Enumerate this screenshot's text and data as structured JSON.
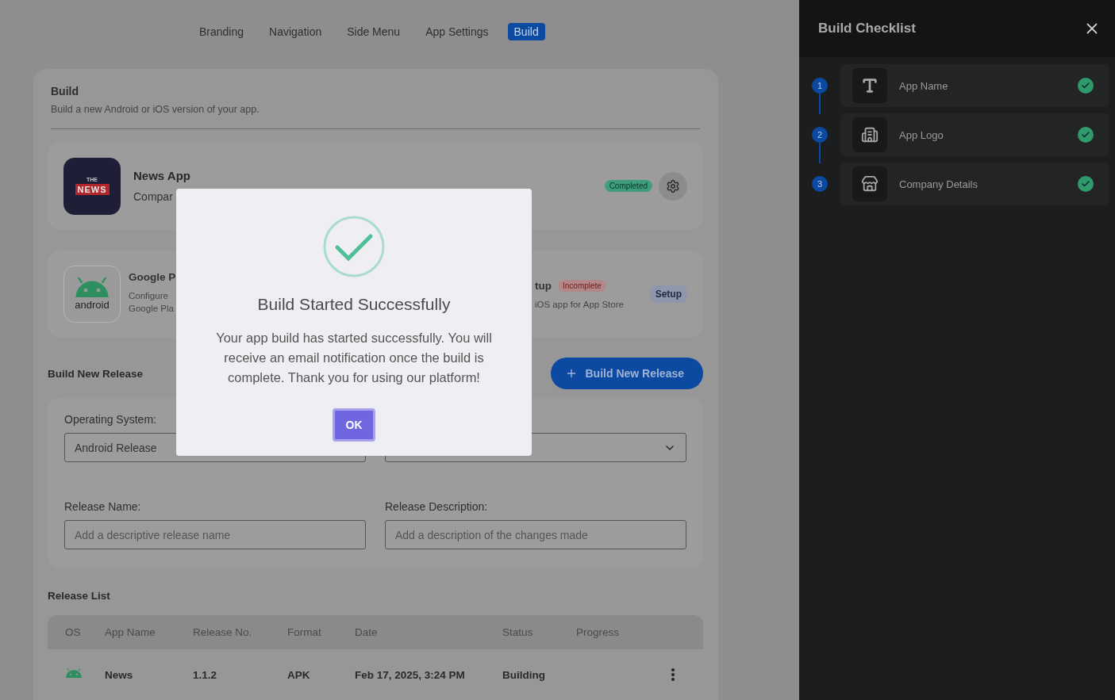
{
  "tabs": [
    {
      "label": "Branding",
      "selected": false
    },
    {
      "label": "Navigation",
      "selected": false
    },
    {
      "label": "Side Menu",
      "selected": false
    },
    {
      "label": "App Settings",
      "selected": false
    },
    {
      "label": "Build",
      "selected": true
    }
  ],
  "build_panel": {
    "title": "Build",
    "subtitle": "Build a new Android or iOS version of your app."
  },
  "app_card": {
    "logo_top": "THE",
    "logo_main": "NEWS",
    "name": "News App",
    "company": "Compar",
    "status": {
      "label": "Completed",
      "kind": "complete"
    }
  },
  "platform_card": {
    "android_logo": "android",
    "title": "Google P",
    "lines": [
      "Configure",
      "Google Pla"
    ],
    "ios_title": "tup",
    "ios_status": {
      "label": "Incomplete",
      "kind": "incomplete"
    },
    "ios_description": "iOS app for App Store",
    "setup_button": "Setup"
  },
  "new_release": {
    "title": "Build New Release",
    "button": "Build New Release",
    "os_label": "Operating System:",
    "os_value": "Android Release",
    "name_label": "Release Name:",
    "name_placeholder": "Add a descriptive release name",
    "desc_label": "Release Description:",
    "desc_placeholder": "Add a description of the changes made"
  },
  "release_list": {
    "title": "Release List",
    "columns": [
      "OS",
      "App Name",
      "Release No.",
      "Format",
      "Date",
      "Status",
      "Progress"
    ],
    "rows": [
      {
        "kind": "android",
        "app_name": "News",
        "release": "1.1.2",
        "format": "APK",
        "date": "Feb 17, 2025, 3:24 PM",
        "status": "Building"
      }
    ]
  },
  "modal": {
    "title": "Build Started Successfully",
    "message": "Your app build has started successfully. You will receive an email notification once the build is complete. Thank you for using our platform!",
    "button": "OK"
  },
  "checklist": {
    "title": "Build Checklist",
    "items": [
      {
        "number": "1",
        "label": "App Name",
        "kind": "text",
        "done": true
      },
      {
        "number": "2",
        "label": "App Logo",
        "kind": "building",
        "done": true
      },
      {
        "number": "3",
        "label": "Company Details",
        "kind": "store",
        "done": true
      }
    ]
  }
}
